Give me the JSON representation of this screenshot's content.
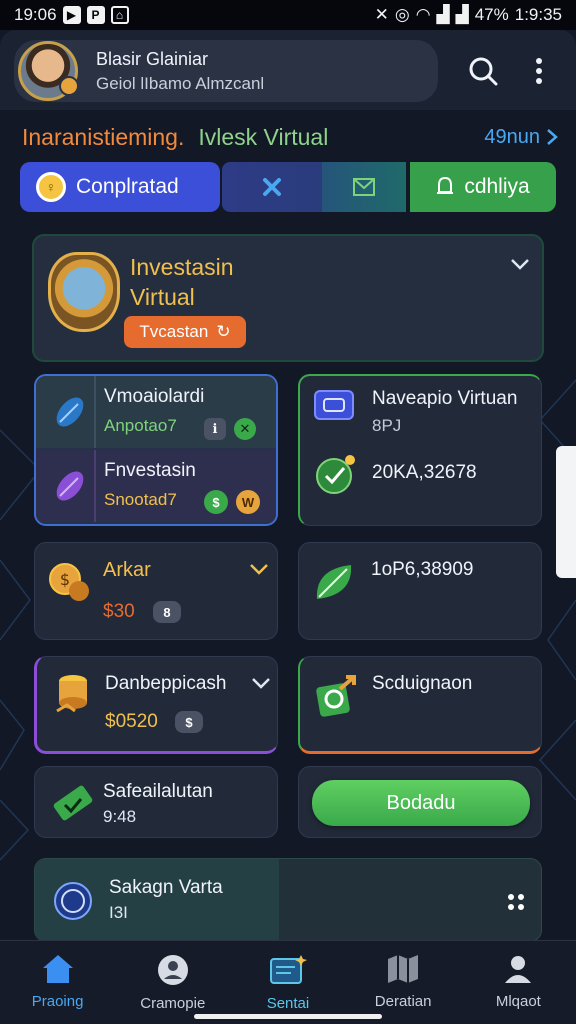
{
  "status_bar": {
    "time_left": "19:06",
    "time_right": "1:9:35",
    "battery": "47%"
  },
  "header": {
    "name": "Blasir Glainiar",
    "subtitle": "Geiol lIbamo Almzcanl",
    "icons": {
      "avatar": "avatar",
      "search": "search-icon",
      "more": "more-vertical-icon"
    }
  },
  "section": {
    "title_primary": "Inaranistieming.",
    "title_secondary": "Ivlesk Virtual",
    "link": "49nun"
  },
  "tabs": [
    {
      "label": "Conplratad",
      "icon": "coin-icon"
    },
    {
      "label": "",
      "icon": "close-x-icon"
    },
    {
      "label": "",
      "icon": "envelope-icon"
    },
    {
      "label": "cdhliya",
      "icon": "bell-icon"
    }
  ],
  "feature": {
    "title_line1": "Investasin",
    "title_line2": "Virtual",
    "pill_label": "Tvcastan"
  },
  "twin_card": {
    "row1": {
      "label": "Vmoaiolardi",
      "sub": "Anpotao7"
    },
    "row2": {
      "label": "Fnvestasin",
      "sub": "Snootad7"
    }
  },
  "cards": {
    "navepio": {
      "title": "Naveapio Virtuan",
      "sub": "8PJ",
      "value": "20KA,32678"
    },
    "arkar": {
      "title": "Arkar",
      "value": "$30"
    },
    "leaf": {
      "value": "1oP6,38909"
    },
    "danbe": {
      "title": "Danbeppicash",
      "value": "$0520"
    },
    "scduig": {
      "title": "Scduignaon"
    },
    "safe": {
      "title": "Safeailalutan",
      "value": "9:48"
    },
    "button": {
      "label": "Bodadu"
    },
    "bottom": {
      "title": "Sakagn Varta",
      "value": "I3I"
    }
  },
  "nav": [
    {
      "label": "Praoing",
      "icon": "home-icon"
    },
    {
      "label": "Cramopie",
      "icon": "profile-circle-icon"
    },
    {
      "label": "Sentai",
      "icon": "card-sparkle-icon"
    },
    {
      "label": "Deratian",
      "icon": "map-icon"
    },
    {
      "label": "Mlqaot",
      "icon": "user-icon"
    }
  ],
  "colors": {
    "background": "#121826",
    "accent_blue": "#3b4fd8",
    "accent_green": "#3aa94a",
    "accent_orange": "#e56b2e",
    "accent_gold": "#f1c04c"
  }
}
